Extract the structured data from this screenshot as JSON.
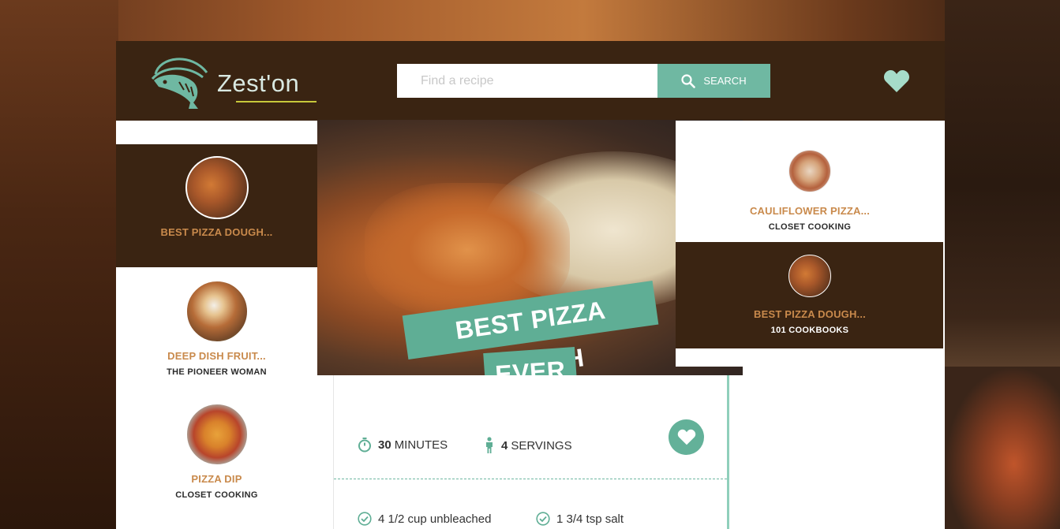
{
  "brand": {
    "name": "Zest'on"
  },
  "search": {
    "placeholder": "Find a recipe",
    "button_label": "SEARCH"
  },
  "left_list": [
    {
      "title": "BEST PIZZA DOUGH...",
      "source": "",
      "active": true,
      "thumb": "pizza-dough"
    },
    {
      "title": "DEEP DISH FRUIT...",
      "source": "THE PIONEER WOMAN",
      "active": false,
      "thumb": "fruit"
    },
    {
      "title": "PIZZA DIP",
      "source": "CLOSET COOKING",
      "active": false,
      "thumb": "pizza-dip"
    }
  ],
  "hero": {
    "title_line1": "BEST PIZZA DOUGH",
    "title_line2": "EVER"
  },
  "right_list": [
    {
      "title": "CAULIFLOWER PIZZA...",
      "source": "CLOSET COOKING",
      "active": false
    },
    {
      "title": "BEST PIZZA DOUGH...",
      "source": "101 COOKBOOKS",
      "active": true
    }
  ],
  "details": {
    "time_value": "30",
    "time_unit": "MINUTES",
    "servings_value": "4",
    "servings_unit": "SERVINGS"
  },
  "ingredients": [
    "4 1/2 cup unbleached",
    "1 3/4 tsp salt"
  ],
  "colors": {
    "brown": "#3a2412",
    "teal": "#6fb8a2",
    "orange": "#c98a4c"
  }
}
